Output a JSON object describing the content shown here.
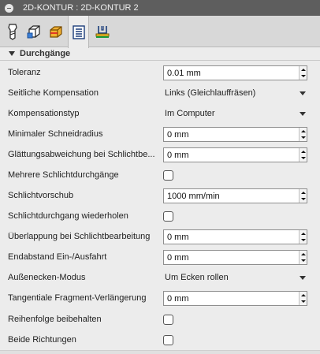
{
  "window": {
    "title": "2D-KONTUR : 2D-KONTUR 2"
  },
  "tabs": [
    {
      "name": "Werkzeug",
      "icon": "tool-icon"
    },
    {
      "name": "Geometrie",
      "icon": "geometry-icon"
    },
    {
      "name": "Höhen",
      "icon": "heights-icon"
    },
    {
      "name": "Durchgänge",
      "icon": "passes-icon",
      "active": true
    },
    {
      "name": "Verknüpfung",
      "icon": "linking-icon"
    }
  ],
  "section": {
    "title": "Durchgänge"
  },
  "fields": {
    "toleranz": {
      "label": "Toleranz",
      "value": "0.01 mm"
    },
    "seitliche_kompensation": {
      "label": "Seitliche Kompensation",
      "value": "Links (Gleichlauffräsen)"
    },
    "kompensationstyp": {
      "label": "Kompensationstyp",
      "value": "Im Computer"
    },
    "min_schneidradius": {
      "label": "Minimaler Schneidradius",
      "value": "0 mm"
    },
    "glaettungsabweichung": {
      "label": "Glättungsabweichung bei Schlichtbe...",
      "value": "0 mm"
    },
    "mehrere_schlicht": {
      "label": "Mehrere Schlichtdurchgänge",
      "checked": false
    },
    "schlichtvorschub": {
      "label": "Schlichtvorschub",
      "value": "1000 mm/min"
    },
    "schlicht_wiederholen": {
      "label": "Schlichtdurchgang wiederholen",
      "checked": false
    },
    "ueberlappung": {
      "label": "Überlappung bei Schlichtbearbeitung",
      "value": "0 mm"
    },
    "endabstand": {
      "label": "Endabstand Ein-/Ausfahrt",
      "value": "0 mm"
    },
    "aussenecken": {
      "label": "Außenecken-Modus",
      "value": "Um Ecken rollen"
    },
    "tangentiale": {
      "label": "Tangentiale Fragment-Verlängerung",
      "value": "0 mm"
    },
    "reihenfolge": {
      "label": "Reihenfolge beibehalten",
      "checked": false
    },
    "beide_richtungen": {
      "label": "Beide Richtungen",
      "checked": false
    }
  }
}
